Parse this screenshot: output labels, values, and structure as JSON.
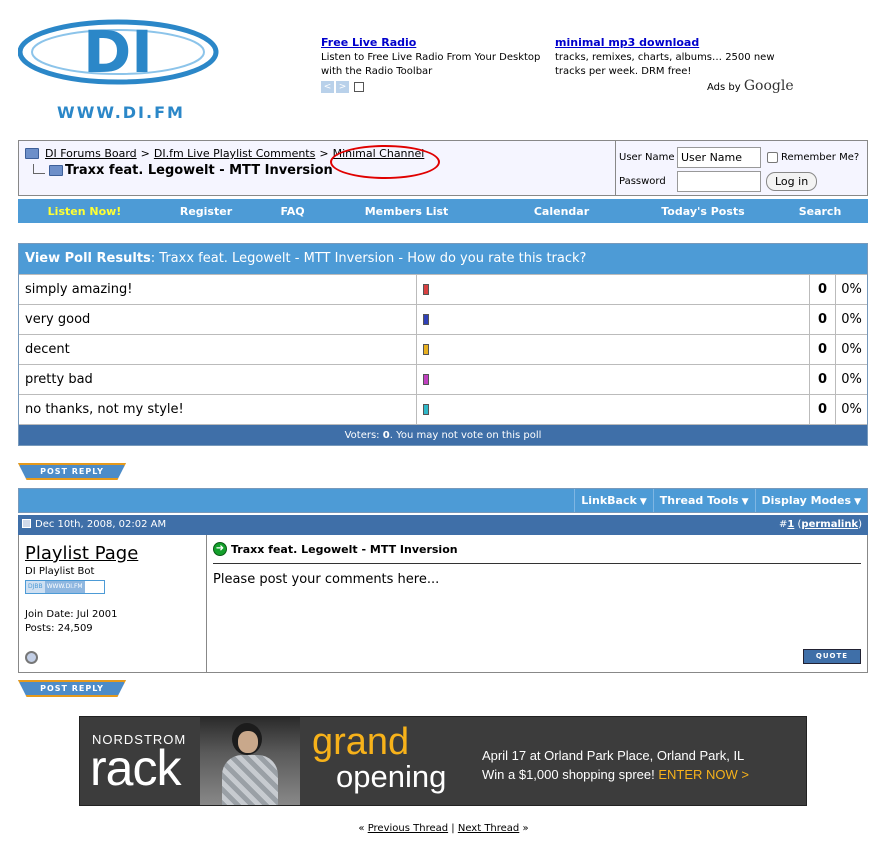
{
  "logo": {
    "text": "DI",
    "url_text": "WWW.DI.FM"
  },
  "ads": {
    "ad1": {
      "title": "Free Live Radio",
      "text": "Listen to Free Live Radio From Your Desktop with the Radio Toolbar"
    },
    "ad2": {
      "title": "minimal mp3 download",
      "text": "tracks, remixes, charts, albums… 2500 new tracks per week. DRM free!"
    },
    "ads_by": "Ads by",
    "google": "Google",
    "prev_arrow": "<",
    "next_arrow": ">"
  },
  "breadcrumb": {
    "items": [
      "DI Forums Board",
      "DI.fm Live Playlist Comments",
      "Minimal Channel"
    ],
    "separator": ">",
    "thread_title": "Traxx feat. Legowelt - MTT Inversion"
  },
  "login": {
    "username_label": "User Name",
    "username_value": "User Name",
    "password_label": "Password",
    "remember_label": "Remember Me?",
    "login_button": "Log in"
  },
  "navbar": {
    "items": [
      "Listen Now!",
      "Register",
      "FAQ",
      "Members List",
      "Calendar",
      "Today's Posts",
      "Search"
    ]
  },
  "poll": {
    "heading_label": "View Poll Results",
    "heading_text": ": Traxx feat. Legowelt - MTT Inversion - How do you rate this track?",
    "options": [
      {
        "label": "simply amazing!",
        "count": "0",
        "percent": "0%",
        "color": "#d94040"
      },
      {
        "label": "very good",
        "count": "0",
        "percent": "0%",
        "color": "#3040b8"
      },
      {
        "label": "decent",
        "count": "0",
        "percent": "0%",
        "color": "#e8b020"
      },
      {
        "label": "pretty bad",
        "count": "0",
        "percent": "0%",
        "color": "#c040c0"
      },
      {
        "label": "no thanks, not my style!",
        "count": "0",
        "percent": "0%",
        "color": "#30b8c8"
      }
    ],
    "voters_label": "Voters:",
    "voters_count": "0",
    "voters_note": ". You may not vote on this poll"
  },
  "reply_button": "POST REPLY",
  "post_tools": {
    "linkback": "LinkBack",
    "thread_tools": "Thread Tools",
    "display_modes": "Display Modes",
    "dropdown_glyph": "▼"
  },
  "post": {
    "date": "Dec 10th, 2008, 02:02 AM",
    "number_prefix": "#",
    "number": "1",
    "permalink": "permalink",
    "author": "Playlist Page",
    "author_title": "DI Playlist Bot",
    "badge_left": "DJBB",
    "badge_right": "WWW.DI.FM",
    "join_date": "Join Date: Jul 2001",
    "posts": "Posts: 24,509",
    "title": "Traxx feat. Legowelt - MTT Inversion",
    "arrow_glyph": "➜",
    "message": "Please post your comments here...",
    "quote_button": "QUOTE"
  },
  "banner": {
    "brand": "NORDSTROM",
    "rack": "rack",
    "grand": "grand",
    "opening": "opening",
    "line1": "April 17 at Orland Park Place, Orland Park, IL",
    "line2": "Win a $1,000 shopping spree!",
    "enter": "ENTER NOW >"
  },
  "thread_nav": {
    "prev": "Previous Thread",
    "next": "Next Thread",
    "left_quote": "«",
    "right_quote": "»",
    "divider": "|"
  },
  "colors": {
    "accent": "#4d9bd6",
    "dark_accent": "#3f6fa8",
    "highlight": "#ffff33",
    "circle": "#e00000"
  }
}
